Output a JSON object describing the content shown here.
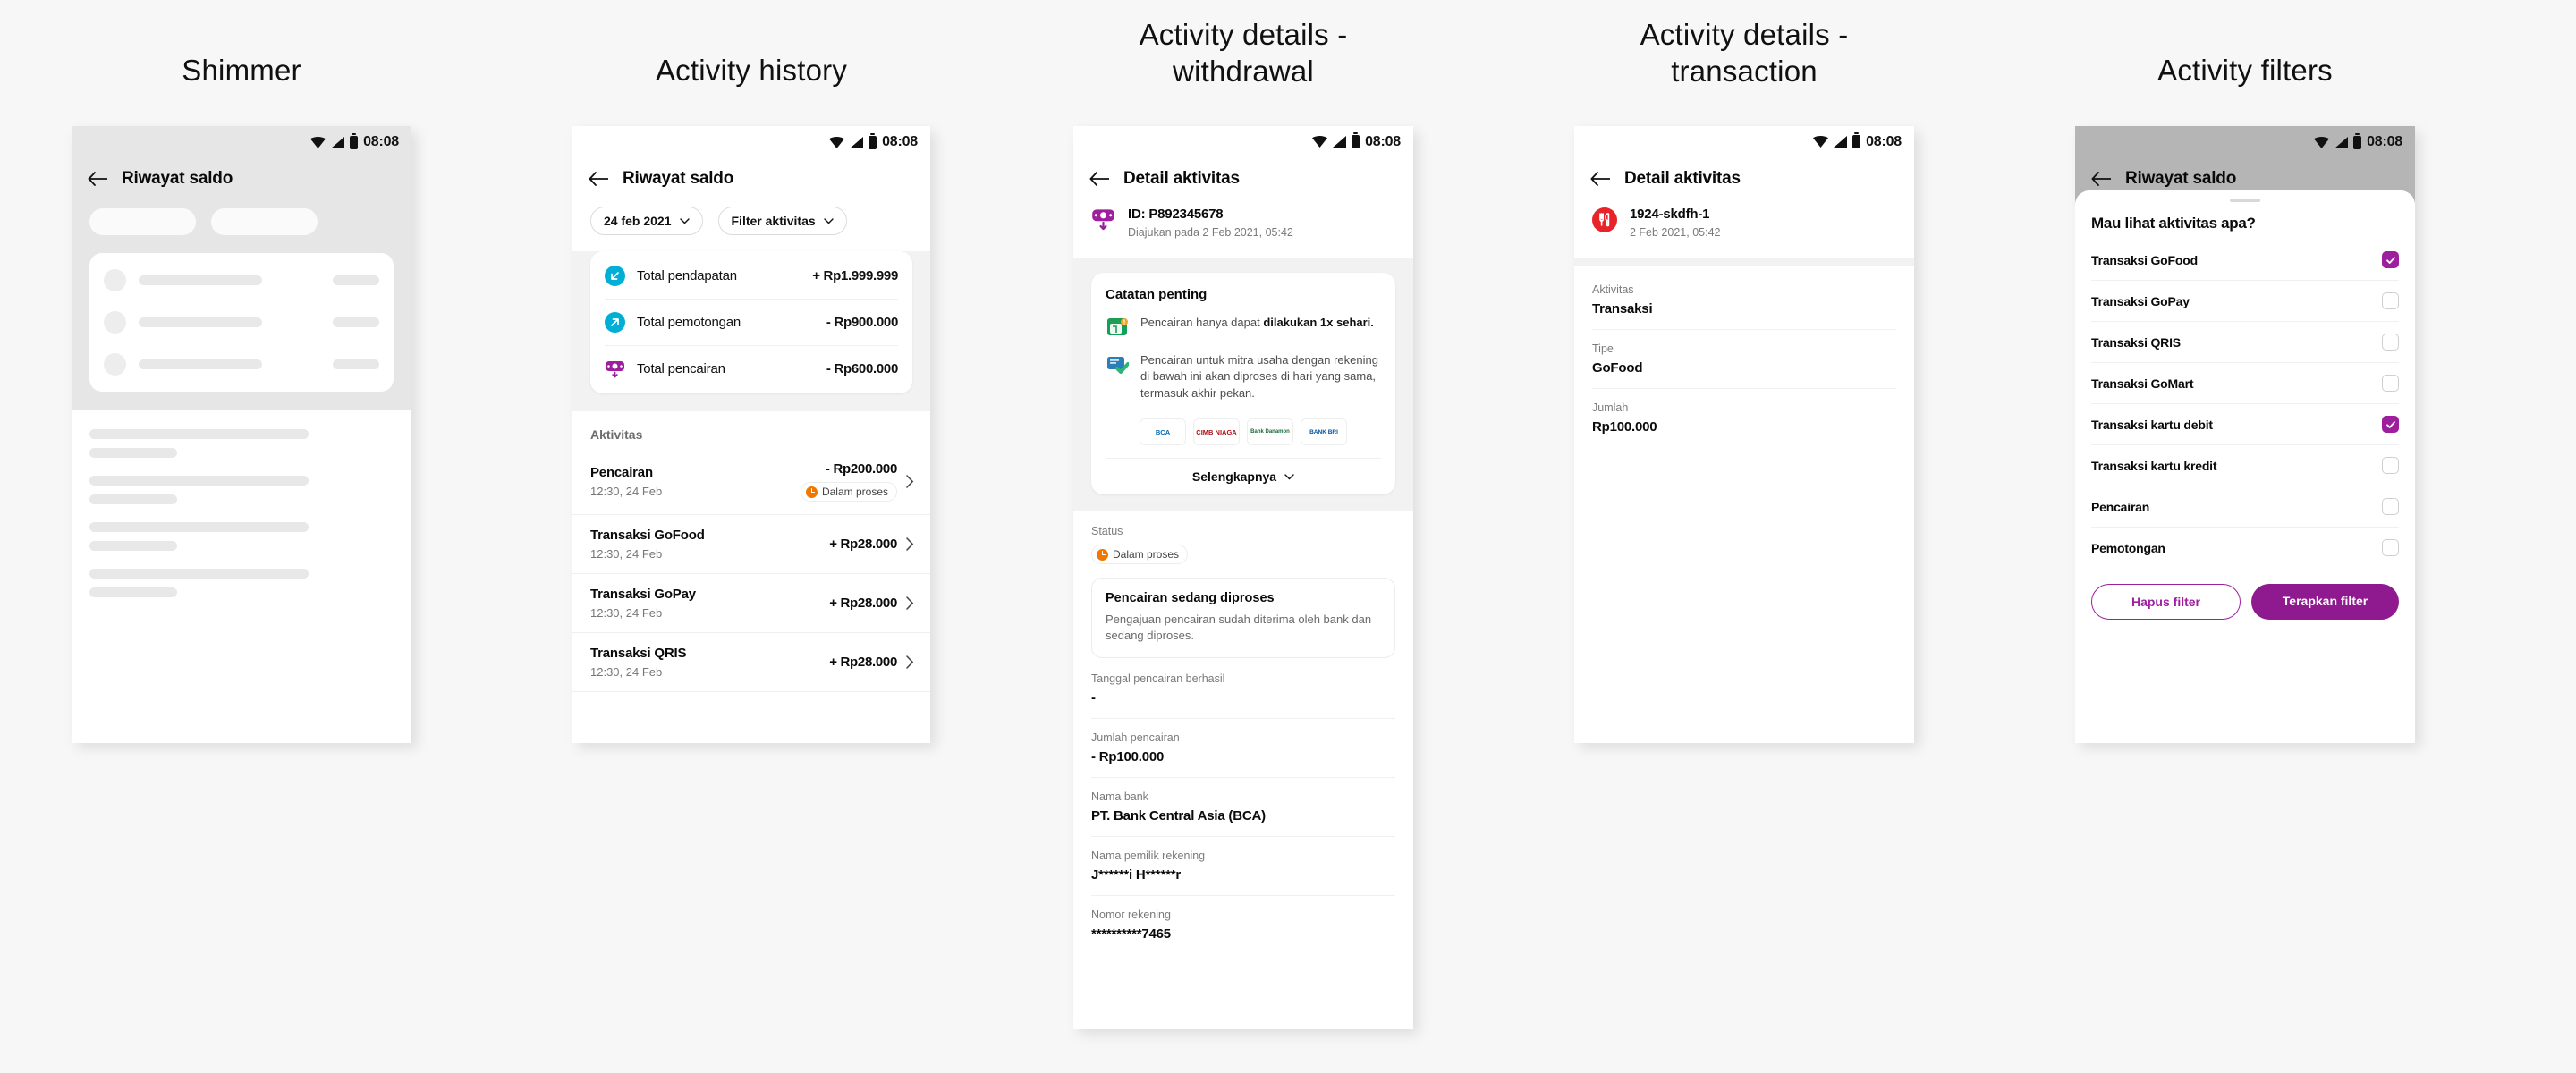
{
  "columns": [
    {
      "title": "Shimmer"
    },
    {
      "title": "Activity history"
    },
    {
      "title": "Activity details -\nwithdrawal"
    },
    {
      "title": "Activity details -\ntransaction"
    },
    {
      "title": "Activity filters"
    }
  ],
  "status_bar": {
    "time": "08:08",
    "wifi_icon": "wifi-icon",
    "signal_icon": "signal-icon",
    "battery_icon": "battery-icon"
  },
  "shimmer": {
    "app_title": "Riwayat saldo",
    "back_icon": "back-arrow-icon"
  },
  "history": {
    "app_title": "Riwayat saldo",
    "back_icon": "back-arrow-icon",
    "chips": [
      {
        "label": "24 feb 2021",
        "icon": "chevron-down-icon"
      },
      {
        "label": "Filter aktivitas",
        "icon": "chevron-down-icon"
      }
    ],
    "summary": [
      {
        "icon": "arrow-down-left-circle-icon",
        "label": "Total pendapatan",
        "value": "+ Rp1.999.999",
        "color": "#00AED6"
      },
      {
        "icon": "arrow-up-right-circle-icon",
        "label": "Total pemotongan",
        "value": "- Rp900.000",
        "color": "#00AED6"
      },
      {
        "icon": "withdrawal-money-icon",
        "label": "Total pencairan",
        "value": "- Rp600.000",
        "color": "#9E1F9E"
      }
    ],
    "section_title": "Aktivitas",
    "items": [
      {
        "title": "Pencairan",
        "time": "12:30, 24 Feb",
        "amount": "- Rp200.000",
        "badge": "Dalam proses",
        "chevron": "chevron-right-icon"
      },
      {
        "title": "Transaksi GoFood",
        "time": "12:30, 24 Feb",
        "amount": "+ Rp28.000",
        "badge": "",
        "chevron": "chevron-right-icon"
      },
      {
        "title": "Transaksi GoPay",
        "time": "12:30, 24 Feb",
        "amount": "+ Rp28.000",
        "badge": "",
        "chevron": "chevron-right-icon"
      },
      {
        "title": "Transaksi QRIS",
        "time": "12:30, 24 Feb",
        "amount": "+ Rp28.000",
        "badge": "",
        "chevron": "chevron-right-icon"
      }
    ]
  },
  "withdrawal": {
    "app_title": "Detail aktivitas",
    "back_icon": "back-arrow-icon",
    "header": {
      "icon": "withdrawal-money-icon",
      "id": "ID: P892345678",
      "submitted": "Diajukan pada 2 Feb 2021, 05:42"
    },
    "note": {
      "title": "Catatan penting",
      "lines": [
        {
          "icon": "calendar-icon",
          "text_plain": "Pencairan hanya dapat ",
          "text_bold": "dilakukan 1x sehari."
        },
        {
          "icon": "bank-card-check-icon",
          "text_plain": "Pencairan untuk mitra usaha dengan rekening di bawah ini akan diproses di hari yang sama, termasuk akhir pekan.",
          "text_bold": ""
        }
      ],
      "banks": [
        "BCA",
        "CIMB NIAGA",
        "Bank Danamon",
        "BANK BRI"
      ],
      "more_label": "Selengkapnya",
      "more_icon": "chevron-down-icon"
    },
    "status": {
      "label": "Status",
      "badge": "Dalam proses",
      "info_title": "Pencairan sedang diproses",
      "info_body": "Pengajuan pencairan sudah diterima oleh bank dan sedang diproses."
    },
    "fields": [
      {
        "label": "Tanggal pencairan berhasil",
        "value": "-"
      },
      {
        "label": "Jumlah pencairan",
        "value": "- Rp100.000"
      },
      {
        "label": "Nama bank",
        "value": "PT. Bank Central Asia (BCA)"
      },
      {
        "label": "Nama pemilik rekening",
        "value": "J******i H******r"
      },
      {
        "label": "Nomor rekening",
        "value": "**********7465"
      }
    ]
  },
  "transaction": {
    "app_title": "Detail aktivitas",
    "back_icon": "back-arrow-icon",
    "header": {
      "icon": "gofood-icon",
      "id": "1924-skdfh-1",
      "submitted": "2 Feb 2021, 05:42"
    },
    "fields": [
      {
        "label": "Aktivitas",
        "value": "Transaksi"
      },
      {
        "label": "Tipe",
        "value": "GoFood"
      },
      {
        "label": "Jumlah",
        "value": "Rp100.000"
      }
    ]
  },
  "filters": {
    "app_title": "Riwayat saldo",
    "back_icon": "back-arrow-icon",
    "sheet_title": "Mau lihat aktivitas apa?",
    "options": [
      {
        "label": "Transaksi GoFood",
        "checked": true
      },
      {
        "label": "Transaksi GoPay",
        "checked": false
      },
      {
        "label": "Transaksi QRIS",
        "checked": false
      },
      {
        "label": "Transaksi GoMart",
        "checked": false
      },
      {
        "label": "Transaksi kartu debit",
        "checked": true
      },
      {
        "label": "Transaksi kartu kredit",
        "checked": false
      },
      {
        "label": "Pencairan",
        "checked": false
      },
      {
        "label": "Pemotongan",
        "checked": false
      }
    ],
    "clear_label": "Hapus filter",
    "apply_label": "Terapkan filter",
    "accent": "#9E1F9E"
  }
}
